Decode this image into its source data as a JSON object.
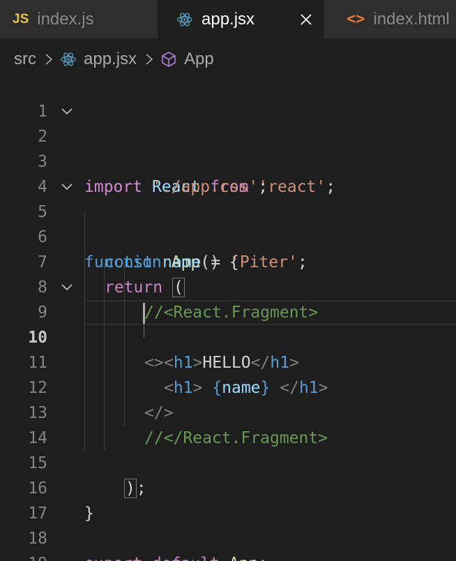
{
  "tabs": [
    {
      "icon": "JS",
      "label": "index.js",
      "active": false
    },
    {
      "icon": "react-icon",
      "label": "app.jsx",
      "active": true
    },
    {
      "icon": "<>",
      "label": "index.html",
      "active": false
    }
  ],
  "breadcrumb": {
    "folder": "src",
    "file": "app.jsx",
    "symbol": "App"
  },
  "line_numbers": [
    "1",
    "2",
    "3",
    "4",
    "5",
    "6",
    "7",
    "8",
    "9",
    "10",
    "11",
    "12",
    "13",
    "14",
    "15",
    "16",
    "17",
    "18",
    "19"
  ],
  "active_line": "10",
  "code": {
    "l2": {
      "a": "import",
      "b": "React",
      "c": "from",
      "d": "'react'",
      "e": ";"
    },
    "l3": {
      "a": "import",
      "b": "'./app.css'",
      "c": ";"
    },
    "l5": {
      "a": "function",
      "b": "App",
      "c": "() {"
    },
    "l6": {
      "a": "const",
      "b": "name",
      "c": " = ",
      "d": "'Piter'",
      "e": ";"
    },
    "l7": {
      "a": "return",
      "b": "("
    },
    "l8": {
      "a": "//<React.Fragment>"
    },
    "l9": {
      "a": "<>"
    },
    "l10": {
      "a": "<",
      "b": "h1",
      "c": ">",
      "d": "HELLO",
      "e": "</",
      "f": "h1",
      "g": ">"
    },
    "l11": {
      "a": "<",
      "b": "h1",
      "c": ">",
      "d": "{",
      "e": "name",
      "f": "}",
      "g": "</",
      "h": "h1",
      "i": ">"
    },
    "l12": {
      "a": "</>"
    },
    "l13": {
      "a": "//</React.Fragment>"
    },
    "l15": {
      "a": ")",
      "b": ";"
    },
    "l16": {
      "a": "}"
    },
    "l18": {
      "a": "export",
      "b": "default",
      "c": "App",
      "d": ";"
    }
  }
}
